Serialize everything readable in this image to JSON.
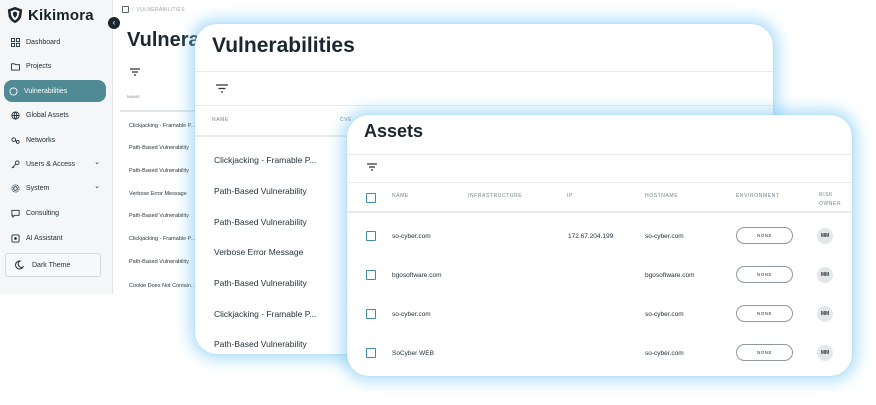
{
  "brand": {
    "name": "Kikimora"
  },
  "sidebar": {
    "items": [
      {
        "label": "Dashboard",
        "icon": "dashboard-icon",
        "active": false,
        "expandable": false
      },
      {
        "label": "Projects",
        "icon": "folder-icon",
        "active": false,
        "expandable": false
      },
      {
        "label": "Vulnerabilities",
        "icon": "circle-icon",
        "active": true,
        "expandable": false
      },
      {
        "label": "Global Assets",
        "icon": "globe-icon",
        "active": false,
        "expandable": false
      },
      {
        "label": "Networks",
        "icon": "network-icon",
        "active": false,
        "expandable": false
      },
      {
        "label": "Users & Access",
        "icon": "key-icon",
        "active": false,
        "expandable": true
      },
      {
        "label": "System",
        "icon": "gear-icon",
        "active": false,
        "expandable": true
      },
      {
        "label": "Consulting",
        "icon": "chat-icon",
        "active": false,
        "expandable": false
      },
      {
        "label": "AI Assistant",
        "icon": "ai-icon",
        "active": false,
        "expandable": false
      }
    ],
    "theme_button": "Dark Theme"
  },
  "header": {
    "breadcrumb": "VULNERABILITIES",
    "title": "Vulnerabilities"
  },
  "back_table": {
    "column": "NAME",
    "rows": [
      "Clickjacking - Framable P...",
      "Path-Based Vulnerability",
      "Path-Based Vulnerability",
      "Verbose Error Message",
      "Path-Based Vulnerability",
      "Clickjacking - Framable P...",
      "Path-Based Vulnerability",
      "Cookie Does Not Contain..."
    ]
  },
  "vuln_card": {
    "title": "Vulnerabilities",
    "columns": [
      "NAME",
      "CVE"
    ],
    "rows": [
      "Clickjacking - Framable P...",
      "Path-Based Vulnerability",
      "Path-Based Vulnerability",
      "Verbose Error Message",
      "Path-Based Vulnerability",
      "Clickjacking - Framable P...",
      "Path-Based Vulnerability"
    ]
  },
  "assets_card": {
    "title": "Assets",
    "columns": {
      "name": "NAME",
      "infrastructure": "INFRASTRUCTURE",
      "ip": "IP",
      "hostname": "HOSTNAME",
      "environment": "ENVIRONMENT",
      "risk_owner_1": "RISK",
      "risk_owner_2": "OWNER"
    },
    "rows": [
      {
        "name": "so-cyber.com",
        "ip": "172.67.204.199",
        "hostname": "so-cyber.com",
        "environment": "NONE",
        "owner": "MM"
      },
      {
        "name": "bgosoftware.com",
        "ip": "",
        "hostname": "bgosoftware.com",
        "environment": "NONE",
        "owner": "MM"
      },
      {
        "name": "so-cyber.com",
        "ip": "",
        "hostname": "so-cyber.com",
        "environment": "NONE",
        "owner": "MM"
      },
      {
        "name": "SoCyber WEB",
        "ip": "",
        "hostname": "so-cyber.com",
        "environment": "NONE",
        "owner": "MM"
      }
    ]
  },
  "colors": {
    "accent": "#4f8a95",
    "checkbox": "#3f8da0",
    "glow": "#78c8f5"
  }
}
